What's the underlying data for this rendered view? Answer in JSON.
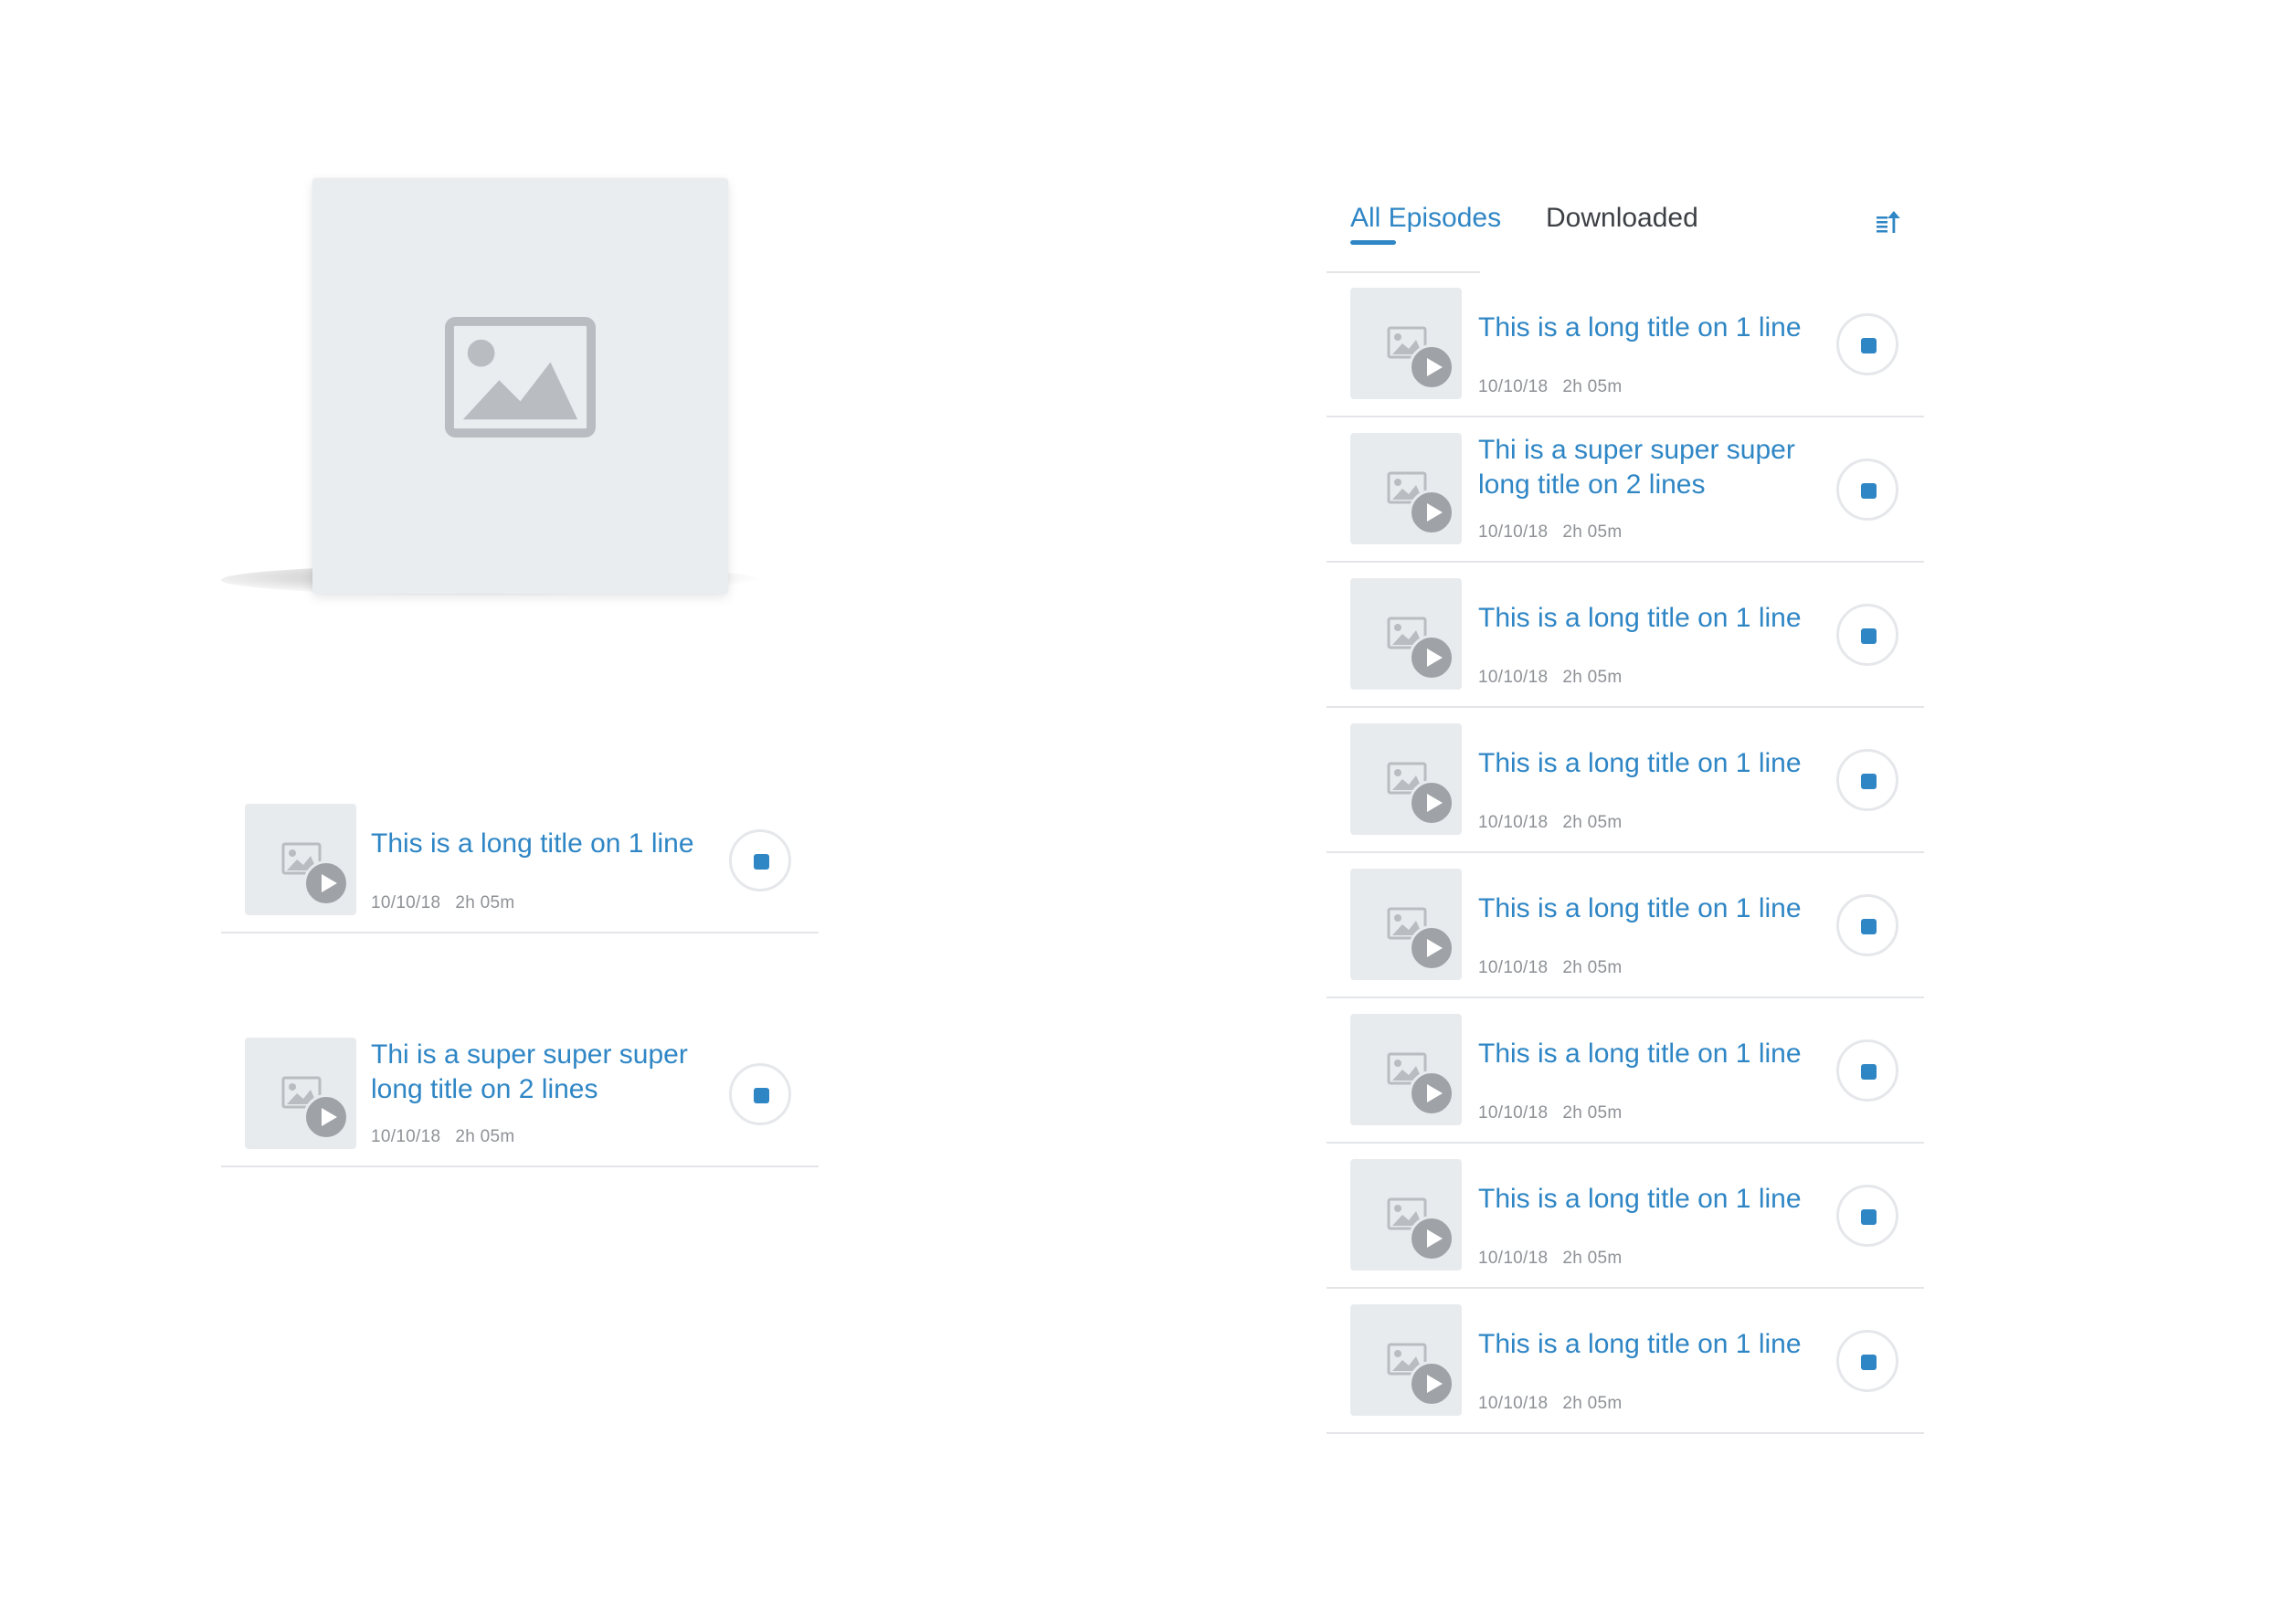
{
  "colors": {
    "accent": "#2f86c5",
    "placeholder_bg": "#eaedf0",
    "placeholder_icon": "#b9bcc0",
    "meta_text": "#8e9196",
    "divider": "#e3e5e8"
  },
  "left_panel": {
    "cover_icon": "image-placeholder-icon",
    "episodes": [
      {
        "title": "This is a long title on 1 line",
        "date": "10/10/18",
        "duration": "2h 05m"
      },
      {
        "title": "Thi is a super super super long title on 2 lines",
        "date": "10/10/18",
        "duration": "2h 05m"
      }
    ]
  },
  "right_panel": {
    "tabs": [
      {
        "label": "All Episodes",
        "active": true
      },
      {
        "label": "Downloaded",
        "active": false
      }
    ],
    "sort_icon": "sort-ascending-icon",
    "episodes": [
      {
        "title": "This is a long title on 1 line",
        "date": "10/10/18",
        "duration": "2h 05m"
      },
      {
        "title": "Thi is a super super super long title on 2 lines",
        "date": "10/10/18",
        "duration": "2h 05m"
      },
      {
        "title": "This is a long title on 1 line",
        "date": "10/10/18",
        "duration": "2h 05m"
      },
      {
        "title": "This is a long title on 1 line",
        "date": "10/10/18",
        "duration": "2h 05m"
      },
      {
        "title": "This is a long title on 1 line",
        "date": "10/10/18",
        "duration": "2h 05m"
      },
      {
        "title": "This is a long title on 1 line",
        "date": "10/10/18",
        "duration": "2h 05m"
      },
      {
        "title": "This is a long title on 1 line",
        "date": "10/10/18",
        "duration": "2h 05m"
      },
      {
        "title": "This is a long title on 1 line",
        "date": "10/10/18",
        "duration": "2h 05m"
      }
    ],
    "row_icons": {
      "thumbnail": "image-placeholder-icon",
      "badge": "play-icon",
      "action": "stop-icon"
    }
  }
}
